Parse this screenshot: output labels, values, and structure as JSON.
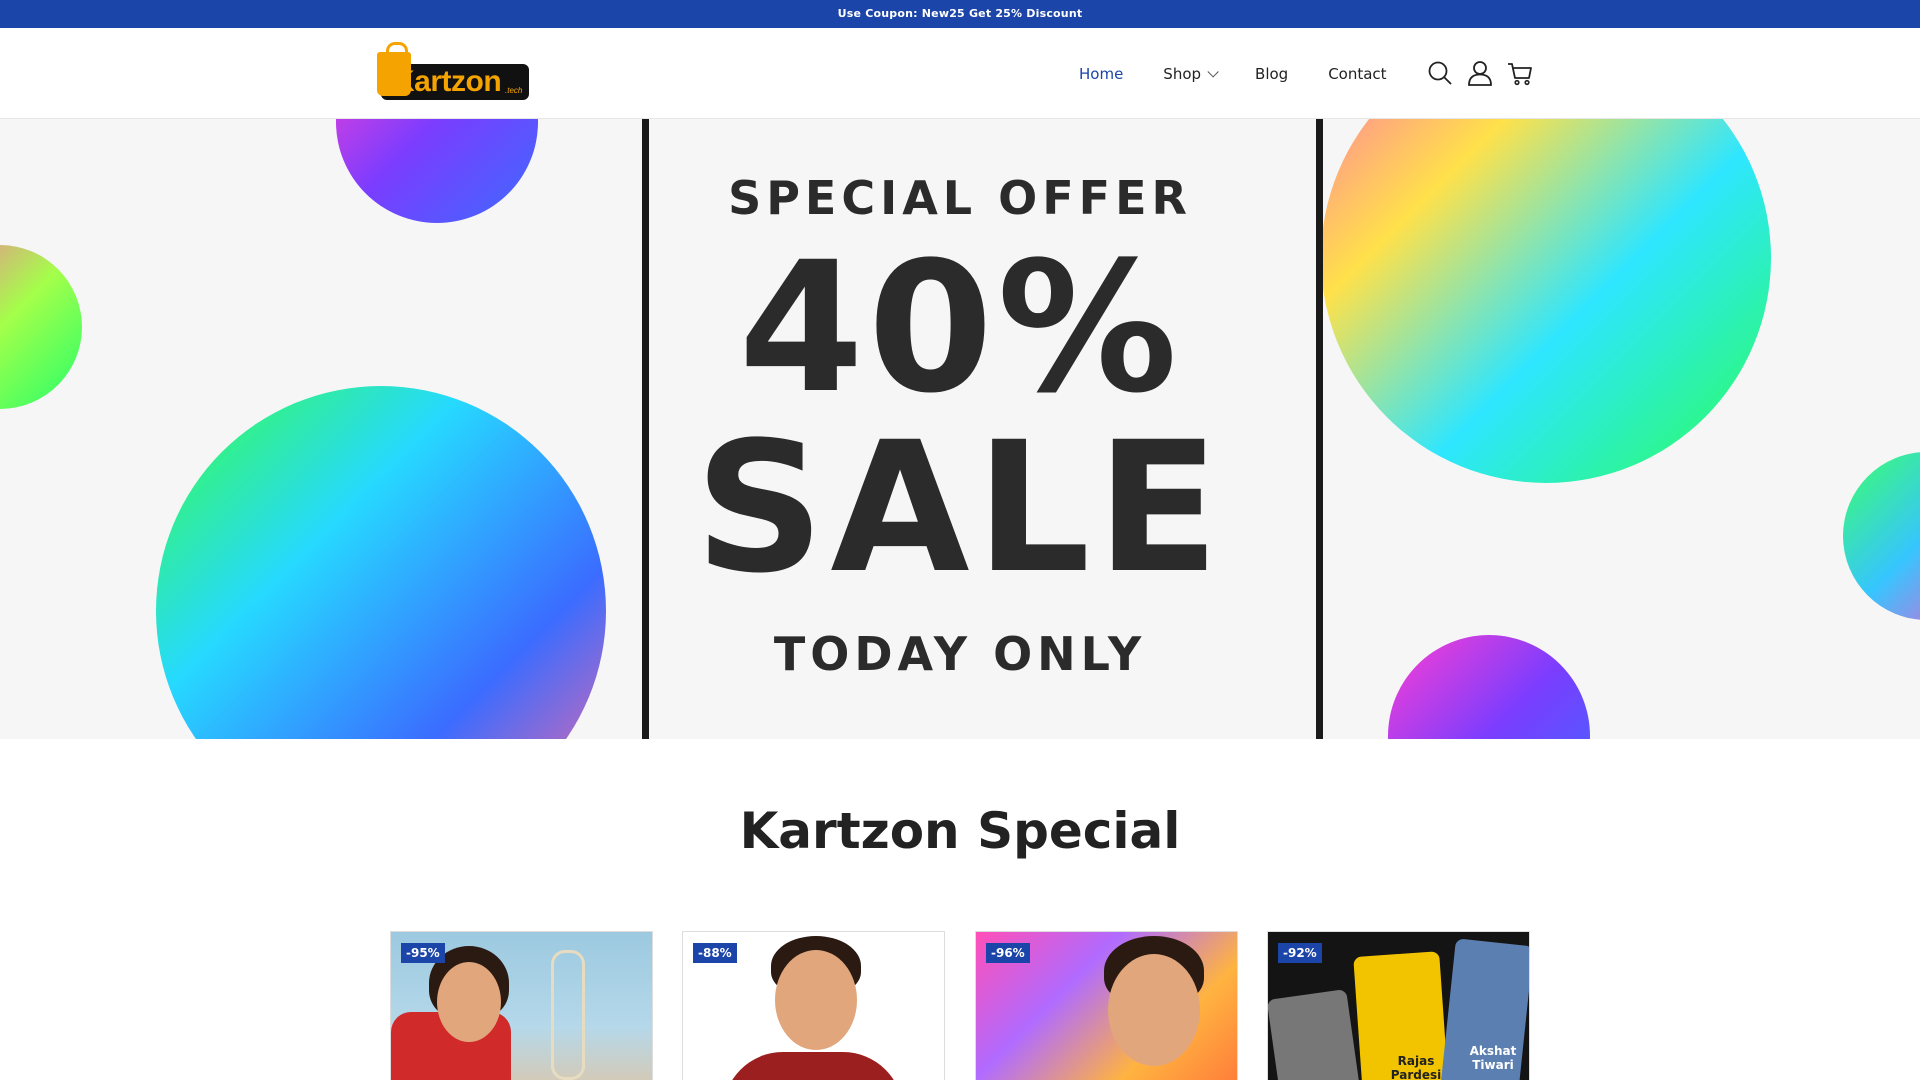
{
  "announcement": "Use Coupon: New25 Get 25% Discount",
  "brand": {
    "name": "Kartzon",
    "suffix": ".tech",
    "accent": "#f5a300"
  },
  "nav": [
    {
      "label": "Home",
      "active": true
    },
    {
      "label": "Shop",
      "has_dropdown": true
    },
    {
      "label": "Blog"
    },
    {
      "label": "Contact"
    }
  ],
  "header_icons": [
    "search-icon",
    "user-icon",
    "cart-icon"
  ],
  "hero": {
    "line1": "SPECIAL OFFER",
    "line2": "40%",
    "line3": "SALE",
    "line4": "TODAY ONLY"
  },
  "section_title": "Kartzon Special",
  "products": [
    {
      "discount": "-95%"
    },
    {
      "discount": "-88%"
    },
    {
      "discount": "-96%"
    },
    {
      "discount": "-92%",
      "labels": [
        "Rajas Pardesi",
        "Akshat Tiwari"
      ]
    }
  ],
  "colors": {
    "primary": "#1b45a8",
    "text": "#222222",
    "hero_bg": "#f6f6f6"
  }
}
